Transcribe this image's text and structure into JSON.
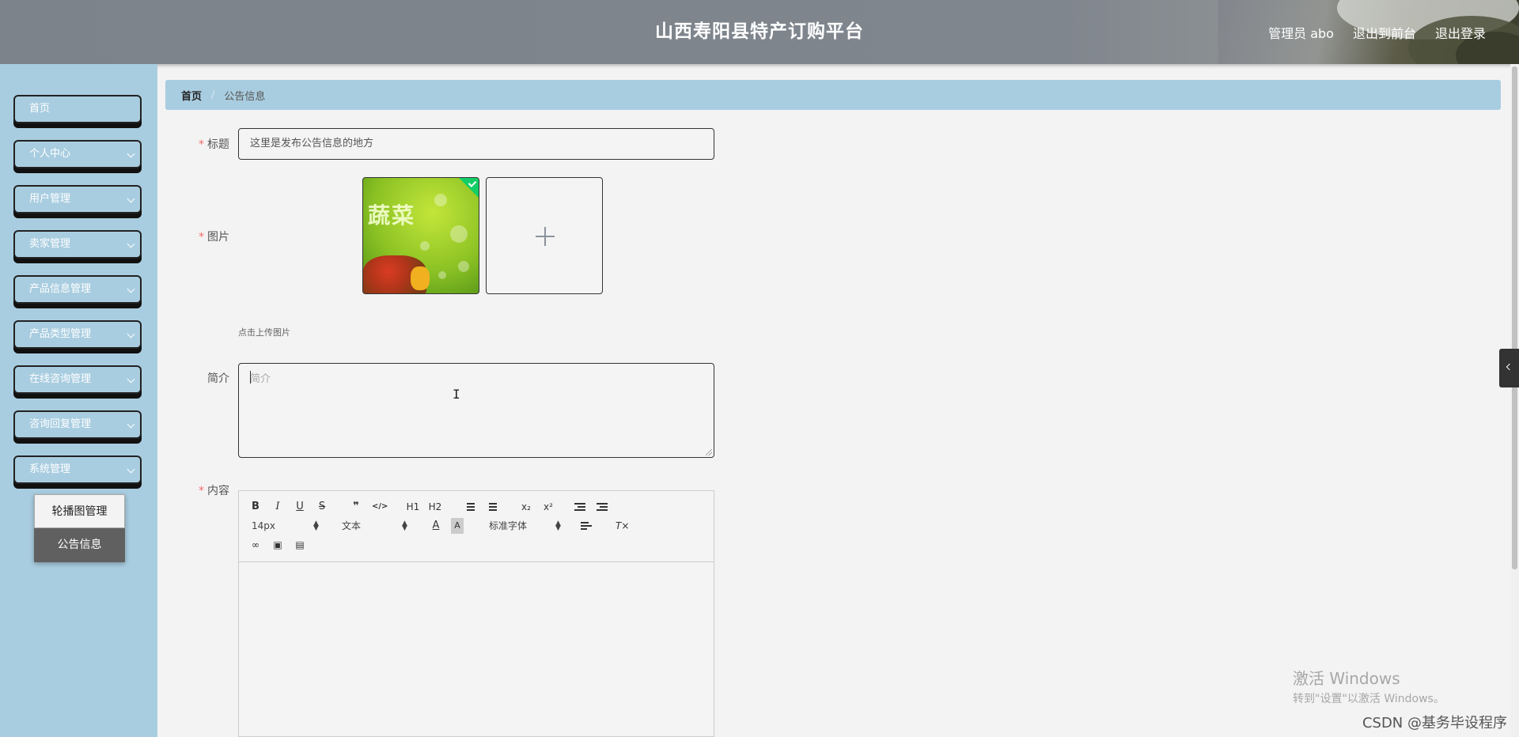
{
  "header": {
    "title": "山西寿阳县特产订购平台",
    "links": [
      "管理员 abo",
      "退出到前台",
      "退出登录"
    ]
  },
  "sidebar": {
    "items": [
      {
        "label": "首页",
        "has_children": false
      },
      {
        "label": "个人中心",
        "has_children": true
      },
      {
        "label": "用户管理",
        "has_children": true
      },
      {
        "label": "卖家管理",
        "has_children": true
      },
      {
        "label": "产品信息管理",
        "has_children": true
      },
      {
        "label": "产品类型管理",
        "has_children": true
      },
      {
        "label": "在线咨询管理",
        "has_children": true
      },
      {
        "label": "咨询回复管理",
        "has_children": true
      },
      {
        "label": "系统管理",
        "has_children": true
      }
    ],
    "submenu": [
      "轮播图管理",
      "公告信息"
    ],
    "active_submenu": "公告信息"
  },
  "breadcrumb": {
    "home": "首页",
    "separator": "/",
    "current": "公告信息"
  },
  "form": {
    "title_label": "标题",
    "title_value": "这里是发布公告信息的地方",
    "image_label": "图片",
    "image_thumb_text": "蔬菜",
    "upload_tip": "点击上传图片",
    "intro_label": "简介",
    "intro_placeholder": "简介",
    "content_label": "内容"
  },
  "editor": {
    "row1": [
      "B",
      "I",
      "U",
      "S",
      "❞",
      "</>",
      "H1",
      "H2",
      "ol",
      "ul",
      "x₂",
      "x²",
      "outdent",
      "indent"
    ],
    "font_size": "14px",
    "paragraph": "文本",
    "font_family": "标准字体",
    "row3": [
      "link",
      "image",
      "video"
    ]
  },
  "watermark": {
    "line1": "激活 Windows",
    "line2": "转到\"设置\"以激活 Windows。"
  },
  "csdn": "CSDN @基务毕设程序",
  "colors": {
    "sidebar": "#a9cde0",
    "required": "#f56c6c",
    "active_submenu": "#606060"
  }
}
